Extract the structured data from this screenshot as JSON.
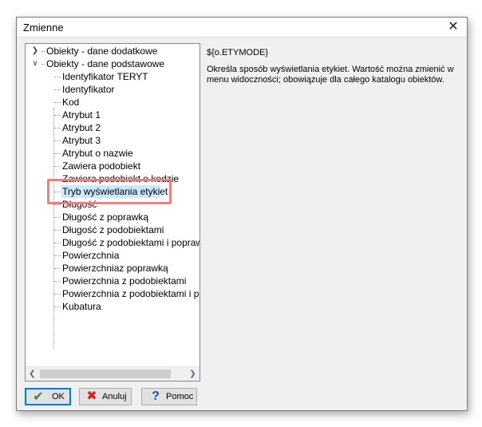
{
  "window": {
    "title": "Zmienne",
    "close_glyph": "✕"
  },
  "tree": {
    "roots": [
      {
        "label": "Obiekty - dane dodatkowe",
        "expanded": false
      },
      {
        "label": "Obiekty - dane podstawowe",
        "expanded": true
      }
    ],
    "children": [
      "Identyfikator TERYT",
      "Identyfikator",
      "Kod",
      "Atrybut 1",
      "Atrybut 2",
      "Atrybut 3",
      "Atrybut o nazwie",
      "Zawiera podobiekt",
      "Zawiera podobiekt o kodzie",
      "Tryb wyświetlania etykiet",
      "Długość",
      "Długość z poprawką",
      "Długość z podobiektami",
      "Długość z podobiektami i poprawką",
      "Powierzchnia",
      "Powierzchniaz poprawką",
      "Powierzchnia z podobiektami",
      "Powierzchnia z podobiektami i poprawką",
      "Kubatura"
    ],
    "selected_index": 9,
    "selection_color": "#cce8ff",
    "highlight_color": "#f08080"
  },
  "info": {
    "variable": "${o.ETYMODE}",
    "description": "Określa sposób wyświetlania etykiet. Wartość można zmienić w menu widoczności; obowiązuje dla całego katalogu obiektów."
  },
  "buttons": {
    "ok": {
      "label": "OK",
      "icon": "check-icon",
      "color": "#2e8b2e"
    },
    "cancel": {
      "label": "Anuluj",
      "icon": "x-icon",
      "color": "#d42020"
    },
    "help": {
      "label": "Pomoc",
      "icon": "question-icon",
      "color": "#1a56c4"
    }
  }
}
